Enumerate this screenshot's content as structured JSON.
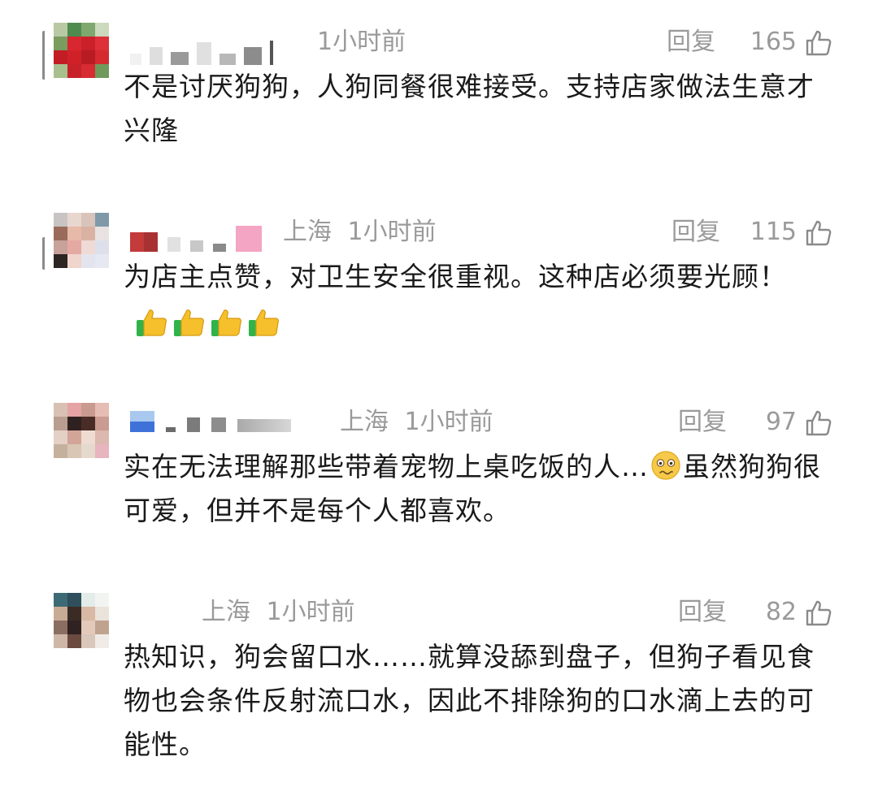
{
  "comments": [
    {
      "location": "",
      "time": "1小时前",
      "reply_label": "回复",
      "likes": "165",
      "text": "不是讨厌狗狗，人狗同餐很难接受。支持店家做法生意才兴隆"
    },
    {
      "location": "上海",
      "time": "1小时前",
      "reply_label": "回复",
      "likes": "115",
      "text": "为店主点赞，对卫生安全很重视。这种店必须要光顾！",
      "emoji": "thumbs-up-icon x4"
    },
    {
      "location": "上海",
      "time": "1小时前",
      "reply_label": "回复",
      "likes": "97",
      "text_before": "实在无法理解那些带着宠物上桌吃饭的人…",
      "text_after": "虽然狗狗很可爱，但并不是每个人都喜欢。",
      "emoji": "woozy-face-icon"
    },
    {
      "location": "上海",
      "time": "1小时前",
      "reply_label": "回复",
      "likes": "82",
      "text": "热知识，狗会留口水……就算没舔到盘子，但狗子看见食物也会条件反射流口水，因此不排除狗的口水滴上去的可能性。"
    }
  ],
  "colors": {
    "meta_gray": "#9a9a9a",
    "text": "#1a1a1a",
    "background": "#ffffff"
  }
}
